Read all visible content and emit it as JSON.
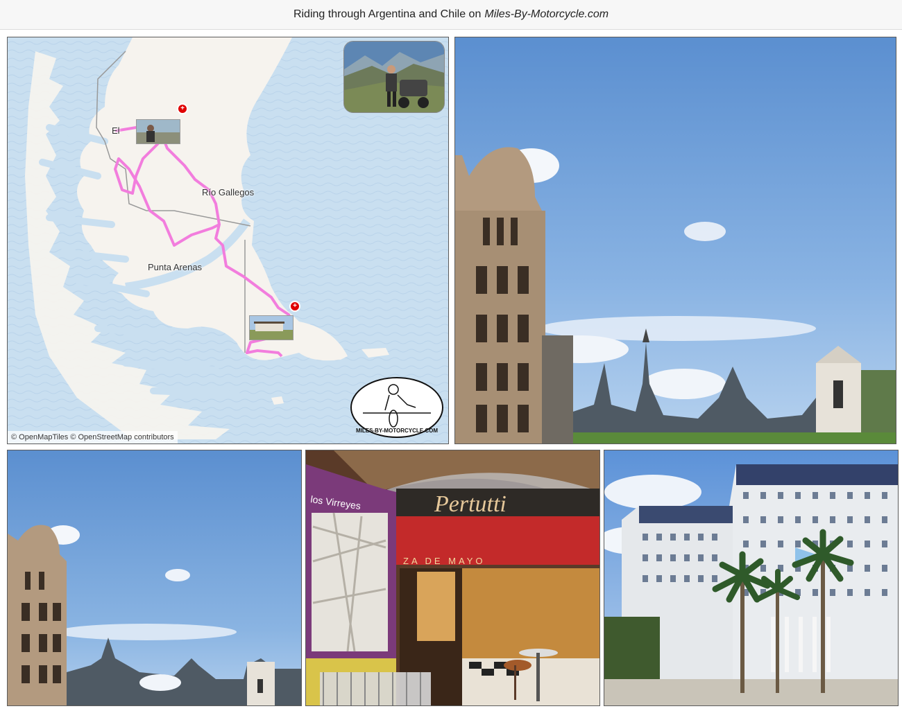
{
  "header": {
    "prefix": "Riding through Argentina and Chile on",
    "site_name": "Miles-By-Motorcycle.com"
  },
  "map": {
    "labels": {
      "rio_gallegos": "Río Gallegos",
      "punta_arenas": "Punta Arenas",
      "el_calafate_partial": "El"
    },
    "attribution": "© OpenMapTiles © OpenStreetMap contributors",
    "marker_symbol": "+",
    "logo_text": "MILES-BY-MOTORCYCLE.COM",
    "route_color": "#f27ddd",
    "water_color": "#c9dff0",
    "land_color": "#f6f3ee",
    "marker_color": "#e00000"
  },
  "photos": [
    {
      "name": "buenos-aires-skyline-large"
    },
    {
      "name": "buenos-aires-skyline-small"
    },
    {
      "name": "pertutti-cafe"
    },
    {
      "name": "edificio-libertador"
    }
  ],
  "cafe": {
    "sign": "Pertutti",
    "awning": "ZA DE MAYO",
    "metro_sign": "los Virreyes"
  }
}
